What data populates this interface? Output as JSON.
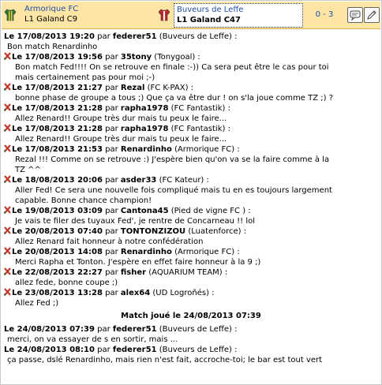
{
  "header": {
    "home_team": "Armorique FC",
    "home_league": "L1 Galand C9",
    "away_team": "Buveurs de Leffe",
    "away_league": "L1 Galand C47",
    "score": "0 - 3",
    "home_jersey_colors": [
      "#2e7d32",
      "#f5c542"
    ],
    "away_jersey_colors": [
      "#c62828",
      "#ffffff"
    ]
  },
  "feed": [
    {
      "date": "Le 17/08/2013 19:20",
      "par": "par",
      "user": "federer51",
      "team": "(Buveurs de Leffe) :",
      "icon": false,
      "lines": [
        "Bon match Renardinho"
      ]
    },
    {
      "date": "Le 17/08/2013 19:56",
      "par": "par",
      "user": "35tony",
      "team": "(Tonygoal) :",
      "icon": true,
      "lines": [
        "Bon match Fed!!!! On se retrouve en finale :-)) Ca sera peut être le cas pour toi",
        "mais certainement pas pour moi ;-)"
      ]
    },
    {
      "date": "Le 17/08/2013 21:27",
      "par": "par",
      "user": "Rezal",
      "team": "(FC K-PAX) :",
      "icon": true,
      "lines": [
        "bonne phase de groupe a tous ;) Que ça va être dur ! on s'la joue comme TZ ;) ?"
      ]
    },
    {
      "date": "Le 17/08/2013 21:28",
      "par": "par",
      "user": "rapha1978",
      "team": "(FC Fantastik) :",
      "icon": true,
      "lines": [
        "Allez Renard!! Groupe très dur mais tu peux le faire..."
      ]
    },
    {
      "date": "Le 17/08/2013 21:28",
      "par": "par",
      "user": "rapha1978",
      "team": "(FC Fantastik) :",
      "icon": true,
      "lines": [
        "Allez Renard!! Groupe très dur mais tu peux le faire..."
      ]
    },
    {
      "date": "Le 17/08/2013 21:53",
      "par": "par",
      "user": "Renardinho",
      "team": "(Armorique FC) :",
      "icon": true,
      "lines": [
        "Rezal !!! Comme on se retrouve :) J'espère bien qu'on va se la faire comme à la",
        "TZ ^^"
      ]
    },
    {
      "date": "Le 18/08/2013 20:06",
      "par": "par",
      "user": "asder33",
      "team": "(FC Kateur) :",
      "icon": true,
      "lines": [
        "Aller Fed! Ce sera une nouvelle fois compliqué mais tu en es toujours largement",
        "capable. Bonne chance champion!"
      ]
    },
    {
      "date": "Le 19/08/2013 03:09",
      "par": "par",
      "user": "Cantona45",
      "team": "(Pied de vigne FC ) :",
      "icon": true,
      "lines": [
        "Je vais te filer des tuyaux Fed', je rentre de Concarneau !! lol"
      ]
    },
    {
      "date": "Le 20/08/2013 07:40",
      "par": "par",
      "user": "TONTONZIZOU",
      "team": "(Luatenforce) :",
      "icon": true,
      "lines": [
        "Allez Renard fait honneur à notre confédération"
      ]
    },
    {
      "date": "Le 20/08/2013 14:08",
      "par": "par",
      "user": "Renardinho",
      "team": "(Armorique FC) :",
      "icon": true,
      "lines": [
        "Merci Rapha et Tonton. J'espère en effet faire honneur à la 9 ;)"
      ]
    },
    {
      "date": "Le 22/08/2013 22:27",
      "par": "par",
      "user": "fisher",
      "team": "(AQUARIUM TEAM) :",
      "icon": true,
      "lines": [
        "allez fede, bonne coupe ;)"
      ]
    },
    {
      "date": "Le 23/08/2013 13:28",
      "par": "par",
      "user": "alex64",
      "team": "(UD Logroñés) :",
      "icon": true,
      "lines": [
        "Allez Fed ;)"
      ]
    }
  ],
  "divider": "Match joué le 24/08/2013 07:39",
  "feed_after": [
    {
      "date": "Le 24/08/2013 07:39",
      "par": "par",
      "user": "federer51",
      "team": "(Buveurs de Leffe) :",
      "icon": false,
      "lines": [
        "merci, on va essayer de s en sortir, mais ..."
      ]
    },
    {
      "date": "Le 24/08/2013 08:10",
      "par": "par",
      "user": "federer51",
      "team": "(Buveurs de Leffe) :",
      "icon": false,
      "lines": [
        "ça passe, dslé Renardinho, mais rien n'est fait, accroche-toi; le bar est tout vert"
      ]
    }
  ]
}
